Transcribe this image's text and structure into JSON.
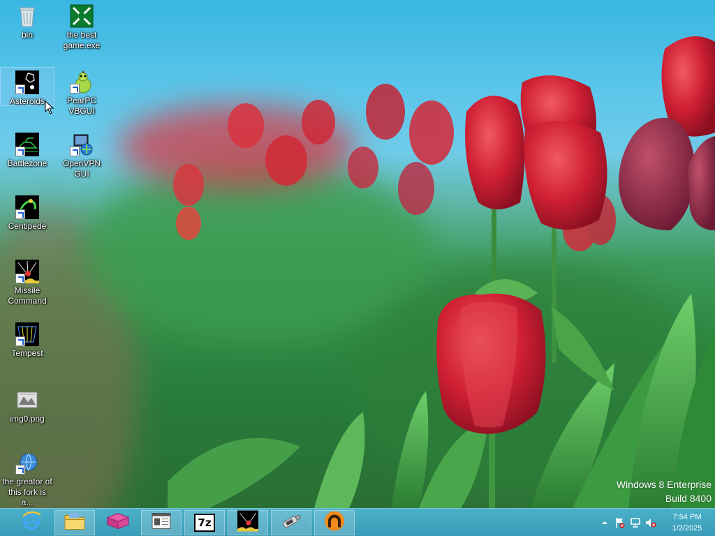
{
  "desktop": {
    "icons": [
      {
        "label": "bin",
        "icon": "recycle-bin-icon"
      },
      {
        "label": "the best game.exe",
        "icon": "game-exe-icon"
      },
      {
        "label": "Asteroids",
        "icon": "asteroids-icon"
      },
      {
        "label": "PearPC VBGUI",
        "icon": "pearpc-icon"
      },
      {
        "label": "Battlezone",
        "icon": "battlezone-icon"
      },
      {
        "label": "OpenVPN GUI",
        "icon": "openvpn-icon"
      },
      {
        "label": "Centipede",
        "icon": "centipede-icon"
      },
      {
        "label": "Missile Command",
        "icon": "missile-command-icon"
      },
      {
        "label": "Tempest",
        "icon": "tempest-icon"
      },
      {
        "label": "img0.png",
        "icon": "image-file-icon"
      },
      {
        "label": "the greator of this fork is a...",
        "icon": "internet-shortcut-icon"
      }
    ],
    "selected": "Asteroids"
  },
  "watermark": {
    "edition": "Windows 8 Enterprise",
    "build": "Build 8400"
  },
  "taskbar": {
    "pinned": [
      {
        "name": "Internet Explorer",
        "icon": "internet-explorer-icon"
      },
      {
        "name": "File Explorer",
        "icon": "file-explorer-icon"
      },
      {
        "name": "App",
        "icon": "pink-box-icon"
      },
      {
        "name": "Window",
        "icon": "window-app-icon"
      },
      {
        "name": "7-Zip",
        "icon": "7zip-icon",
        "text": "7z"
      },
      {
        "name": "Missile Command",
        "icon": "missile-command-icon"
      },
      {
        "name": "USB Tool",
        "icon": "usb-drive-icon"
      },
      {
        "name": "Network App",
        "icon": "orange-arc-icon"
      }
    ]
  },
  "tray": {
    "time": "7:54 PM",
    "date": "1/2/2025"
  },
  "colors": {
    "taskbar": "#3a9cb8",
    "sky": "#38b6e2",
    "tulip": "#d8283a"
  }
}
